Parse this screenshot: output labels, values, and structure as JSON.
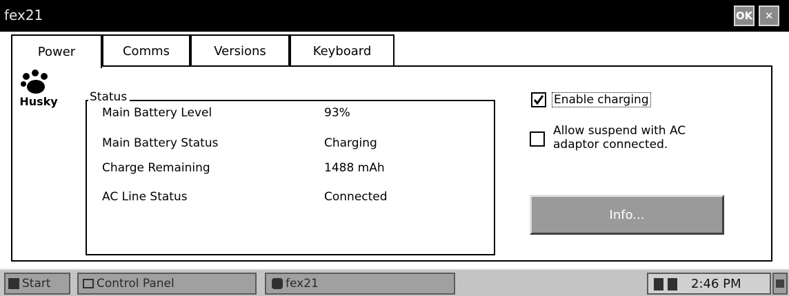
{
  "window": {
    "title": "fex21",
    "ok_label": "OK",
    "close_label": "✕"
  },
  "tabs": [
    {
      "label": "Power"
    },
    {
      "label": "Comms"
    },
    {
      "label": "Versions"
    },
    {
      "label": "Keyboard"
    }
  ],
  "logo": {
    "text": "Husky"
  },
  "status": {
    "legend": "Status",
    "rows": [
      {
        "label": "Main Battery Level",
        "value": "93%"
      },
      {
        "label": "Main Battery Status",
        "value": "Charging"
      },
      {
        "label": "Charge Remaining",
        "value": "1488 mAh"
      },
      {
        "label": "AC Line Status",
        "value": "Connected"
      }
    ]
  },
  "options": {
    "enable_charging": {
      "label": "Enable charging",
      "checked": true
    },
    "allow_suspend": {
      "label_line1": "Allow suspend with AC",
      "label_line2": "adaptor connected.",
      "checked": false
    }
  },
  "info_button": {
    "label": "Info..."
  },
  "taskbar": {
    "start_label": "Start",
    "control_panel_label": "Control Panel",
    "fex21_label": "fex21",
    "clock": "2:46 PM"
  }
}
